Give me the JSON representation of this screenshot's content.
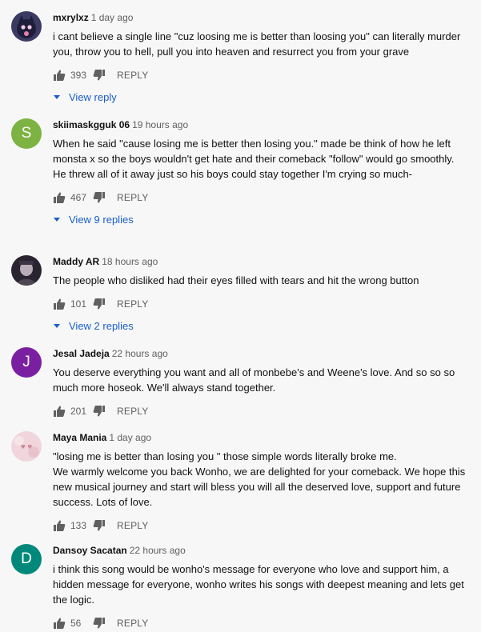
{
  "reply_label": "REPLY",
  "comments": [
    {
      "author": "mxrylxz",
      "time": "1 day ago",
      "text": "i cant believe a single line \"cuz loosing me is better than loosing you\" can literally murder you, throw you to hell, pull you into heaven and resurrect you from your grave",
      "likes": "393",
      "view_replies": "View reply",
      "avatar": {
        "type": "image",
        "color": "#3b3a63"
      }
    },
    {
      "author": "skiimaskgguk 06",
      "time": "19 hours ago",
      "text": "When he said \"cause losing me is better then losing you.\" made be think of how he left monsta x so the boys wouldn't get hate and their comeback \"follow\" would go smoothly. He threw all of it away just so his boys could stay together I'm crying so much-",
      "likes": "467",
      "view_replies": "View 9 replies",
      "avatar": {
        "type": "letter",
        "letter": "S",
        "color": "#7cb342"
      }
    },
    {
      "author": "Maddy AR",
      "time": "18 hours ago",
      "text": "The people who disliked had their eyes filled with tears and hit the wrong button",
      "likes": "101",
      "view_replies": "View 2 replies",
      "avatar": {
        "type": "image",
        "color": "#2a2430"
      }
    },
    {
      "author": "Jesal Jadeja",
      "time": "22 hours ago",
      "text": "You deserve everything you want and all of monbebe's and Weene's love. And so so so much more hoseok. We'll always stand together.",
      "likes": "201",
      "view_replies": "",
      "avatar": {
        "type": "letter",
        "letter": "J",
        "color": "#7b1fa2"
      }
    },
    {
      "author": "Maya Mania",
      "time": "1 day ago",
      "text": "\"losing me is better than losing you \" those simple words literally broke me.\nWe warmly welcome you back Wonho,  we are delighted for your comeback. We hope this new musical journey and start will bless you will all the deserved love, support and future success. Lots of love.",
      "likes": "133",
      "view_replies": "",
      "avatar": {
        "type": "image",
        "color": "#f0d6dc"
      }
    },
    {
      "author": "Dansoy Sacatan",
      "time": "22 hours ago",
      "text": "i think this song would be wonho's message for everyone who love and support him, a hidden message for everyone, wonho writes his songs with deepest meaning and lets get the logic.",
      "likes": "56",
      "view_replies": "",
      "avatar": {
        "type": "letter",
        "letter": "D",
        "color": "#00897b"
      }
    }
  ]
}
